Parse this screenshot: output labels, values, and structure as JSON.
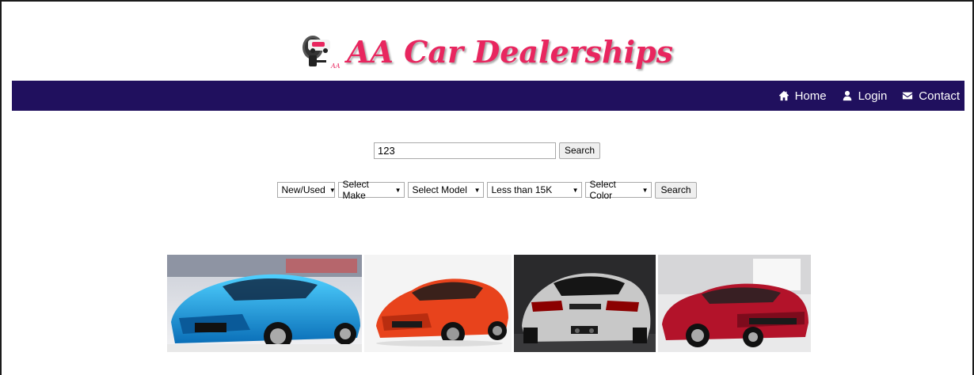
{
  "brand": {
    "title": "AA Car Dealerships",
    "logo_icon": "car-key-icon",
    "color": "#e8265f"
  },
  "nav": {
    "background": "#20105e",
    "items": [
      {
        "label": "Home",
        "icon": "home-icon"
      },
      {
        "label": "Login",
        "icon": "user-icon"
      },
      {
        "label": "Contact",
        "icon": "envelope-icon"
      }
    ]
  },
  "search": {
    "value": "123",
    "button_label": "Search"
  },
  "filters": {
    "condition": "New/Used",
    "make": "Select Make",
    "model": "Select Model",
    "price": "Less than 15K",
    "color": "Select Color",
    "button_label": "Search"
  },
  "cars": [
    {
      "name": "blue-sedan-image",
      "color": "#1aa6e0"
    },
    {
      "name": "orange-hatchback-image",
      "color": "#e8431c"
    },
    {
      "name": "silver-hatchback-image",
      "color": "#c8c8c8"
    },
    {
      "name": "red-sedan-image",
      "color": "#b3132a"
    }
  ]
}
